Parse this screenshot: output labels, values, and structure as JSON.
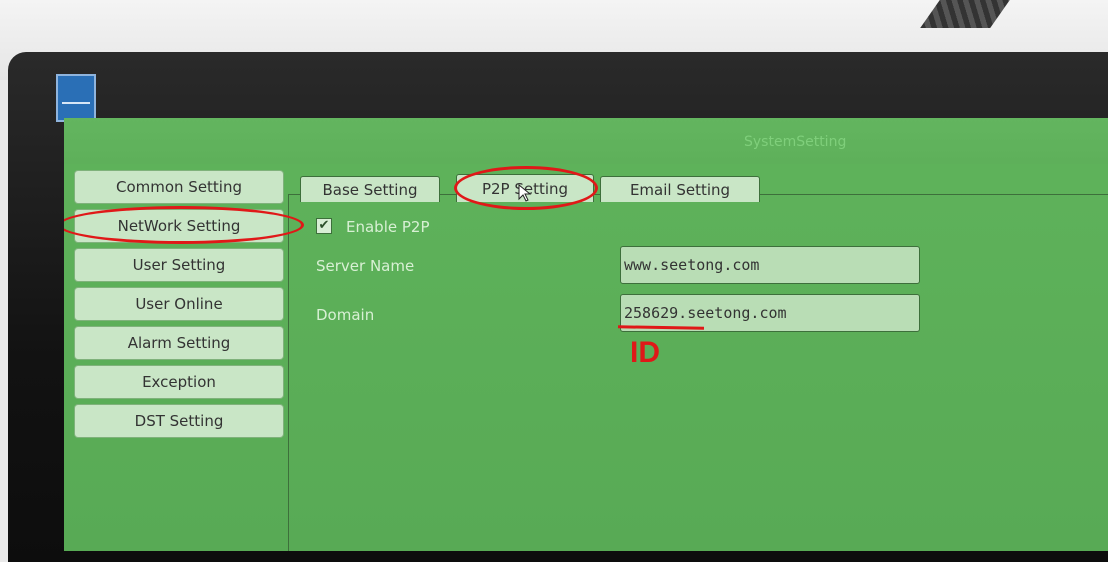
{
  "window": {
    "title": "SystemSetting"
  },
  "sidebar": {
    "items": [
      {
        "label": "Common Setting"
      },
      {
        "label": "NetWork Setting"
      },
      {
        "label": "User Setting"
      },
      {
        "label": "User Online"
      },
      {
        "label": "Alarm Setting"
      },
      {
        "label": "Exception"
      },
      {
        "label": "DST Setting"
      }
    ]
  },
  "tabs": [
    {
      "label": "Base Setting"
    },
    {
      "label": "P2P Setting"
    },
    {
      "label": "Email Setting"
    }
  ],
  "p2p": {
    "enable_label": "Enable P2P",
    "enable_checked": true,
    "server_name_label": "Server Name",
    "server_name_value": "www.seetong.com",
    "domain_label": "Domain",
    "domain_value": "258629.seetong.com"
  },
  "annotation": {
    "id_label": "ID"
  },
  "colors": {
    "screen_bg": "#5fb35b",
    "button_bg": "#c9e6c6",
    "annotation": "#e01818"
  }
}
